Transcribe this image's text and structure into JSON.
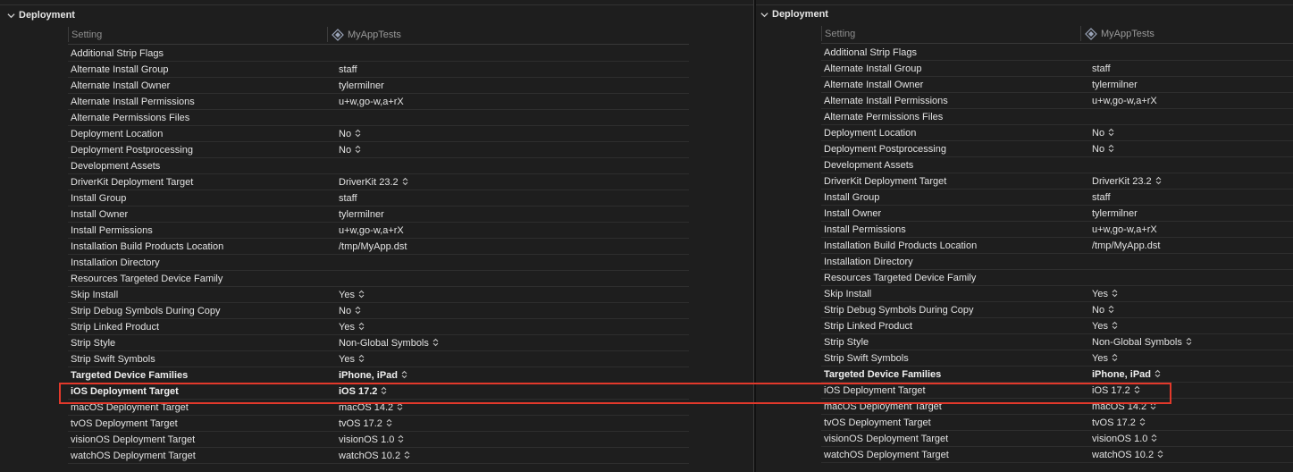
{
  "section_title": "Deployment",
  "columns": {
    "setting": "Setting",
    "target": "MyAppTests"
  },
  "rows": [
    {
      "name": "Additional Strip Flags",
      "value": "",
      "stepper": false,
      "bold": false
    },
    {
      "name": "Alternate Install Group",
      "value": "staff",
      "stepper": false,
      "bold": false
    },
    {
      "name": "Alternate Install Owner",
      "value": "tylermilner",
      "stepper": false,
      "bold": false
    },
    {
      "name": "Alternate Install Permissions",
      "value": "u+w,go-w,a+rX",
      "stepper": false,
      "bold": false
    },
    {
      "name": "Alternate Permissions Files",
      "value": "",
      "stepper": false,
      "bold": false
    },
    {
      "name": "Deployment Location",
      "value": "No",
      "stepper": true,
      "bold": false
    },
    {
      "name": "Deployment Postprocessing",
      "value": "No",
      "stepper": true,
      "bold": false
    },
    {
      "name": "Development Assets",
      "value": "",
      "stepper": false,
      "bold": false
    },
    {
      "name": "DriverKit Deployment Target",
      "value": "DriverKit 23.2",
      "stepper": true,
      "bold": false
    },
    {
      "name": "Install Group",
      "value": "staff",
      "stepper": false,
      "bold": false
    },
    {
      "name": "Install Owner",
      "value": "tylermilner",
      "stepper": false,
      "bold": false
    },
    {
      "name": "Install Permissions",
      "value": "u+w,go-w,a+rX",
      "stepper": false,
      "bold": false
    },
    {
      "name": "Installation Build Products Location",
      "value": "/tmp/MyApp.dst",
      "stepper": false,
      "bold": false
    },
    {
      "name": "Installation Directory",
      "value": "",
      "stepper": false,
      "bold": false
    },
    {
      "name": "Resources Targeted Device Family",
      "value": "",
      "stepper": false,
      "bold": false
    },
    {
      "name": "Skip Install",
      "value": "Yes",
      "stepper": true,
      "bold": false
    },
    {
      "name": "Strip Debug Symbols During Copy",
      "value": "No",
      "stepper": true,
      "bold": false
    },
    {
      "name": "Strip Linked Product",
      "value": "Yes",
      "stepper": true,
      "bold": false
    },
    {
      "name": "Strip Style",
      "value": "Non-Global Symbols",
      "stepper": true,
      "bold": false
    },
    {
      "name": "Strip Swift Symbols",
      "value": "Yes",
      "stepper": true,
      "bold": false
    },
    {
      "name": "Targeted Device Families",
      "value": "iPhone, iPad",
      "stepper": true,
      "bold": true
    },
    {
      "name": "iOS Deployment Target",
      "value": "iOS 17.2",
      "stepper": true,
      "bold": true,
      "bold_right": false
    },
    {
      "name": "macOS Deployment Target",
      "value": "macOS 14.2",
      "stepper": true,
      "bold": false
    },
    {
      "name": "tvOS Deployment Target",
      "value": "tvOS 17.2",
      "stepper": true,
      "bold": false
    },
    {
      "name": "visionOS Deployment Target",
      "value": "visionOS 1.0",
      "stepper": true,
      "bold": false
    },
    {
      "name": "watchOS Deployment Target",
      "value": "watchOS 10.2",
      "stepper": true,
      "bold": false
    }
  ],
  "colors": {
    "highlight": "#e2392b",
    "background": "#1e1e1e"
  }
}
